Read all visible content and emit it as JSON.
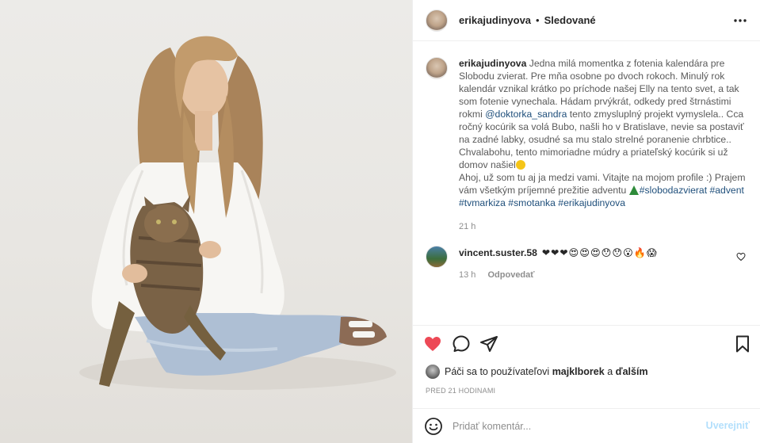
{
  "post": {
    "username": "erikajudinyova",
    "separator": "•",
    "follow_state": "Sledované",
    "caption": {
      "username": "erikajudinyova",
      "text_1": "Jedna milá momentka z fotenia kalendára pre Slobodu zvierat. Pre mňa osobne po dvoch rokoch. Minulý rok kalendár vznikal krátko po príchode našej Elly na tento svet, a tak som fotenie vynechala. Hádam prvýkrát, odkedy pred štrnástimi rokmi ",
      "mention": "@doktorka_sandra",
      "text_2": " tento zmysluplný projekt vymyslela.. Cca ročný kocúrik sa volá Bubo, našli ho v Bratislave, nevie sa postaviť na zadné labky, osudné sa mu stalo strelné poranenie chrbtice.. Chvalabohu, tento mimoriadne múdry a priateľský kocúrik si už domov našiel",
      "text_3": "Ahoj, už som tu aj ja medzi vami. Vitajte na mojom profile :) Prajem vám všetkým príjemné prežitie adventu ",
      "hashtags_1": "#slobodazvierat #advent",
      "hashtags_2": "#tvmarkiza #smotanka #erikajudinyova",
      "time": "21 h"
    },
    "comment": {
      "username": "vincent.suster.58",
      "emojis": "❤❤❤😍😍😍😯😯😮🔥😱",
      "time": "13 h",
      "reply_label": "Odpovedať"
    },
    "likes": {
      "prefix": "Páči sa to používateľovi",
      "user": "majklborek",
      "and": "a",
      "others": "ďalším"
    },
    "posted_ago": "PRED 21 HODINAMI",
    "add_comment": {
      "placeholder": "Pridať komentár...",
      "publish_label": "Uverejniť"
    }
  },
  "icons": {
    "more": "more-dots-icon",
    "like": "heart-filled-icon",
    "comment": "comment-bubble-icon",
    "share": "paper-plane-icon",
    "save": "bookmark-icon",
    "emoji": "smiley-icon",
    "comment_like": "heart-outline-icon"
  },
  "colors": {
    "like_red": "#ed4956",
    "link_blue": "#1f4f7b",
    "muted": "#8e8e8e",
    "publish_disabled": "#b2dffc"
  }
}
